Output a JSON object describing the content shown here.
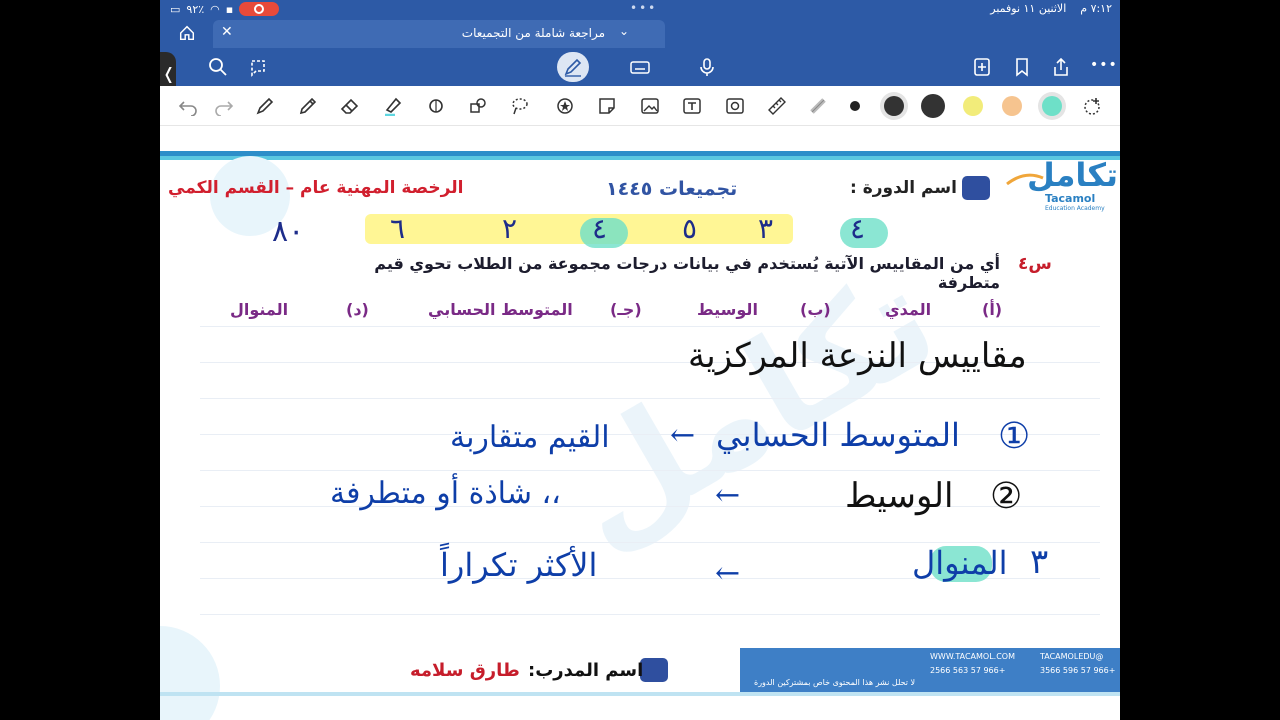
{
  "status_bar": {
    "time": "٧:١٢ م",
    "date": "الاثنين ١١ نوفمبر",
    "battery": "٩٢٪"
  },
  "tab": {
    "title": "مراجعة شاملة من التجميعات"
  },
  "colors": {
    "app_blue": "#2d5aa6",
    "title_red": "#c61d2b",
    "heading_blue": "#3154a3",
    "ink_blue": "#0e3ea8",
    "option_purple": "#7a2a86",
    "highlight_yellow": "#fff58a",
    "highlight_cyan": "#6ee0c8"
  },
  "toolbar_icons": [
    "home-icon",
    "search-icon",
    "lasso-icon",
    "pen-mode-icon",
    "keyboard-icon",
    "microphone-icon",
    "add-page-icon",
    "bookmark-icon",
    "share-icon",
    "more-icon"
  ],
  "pen_tools": [
    "undo-icon",
    "redo-icon",
    "pen-icon",
    "pencil-icon",
    "eraser-icon",
    "highlighter-icon",
    "shapes-icon",
    "elements-icon",
    "lasso-select-icon",
    "sticker-icon",
    "stickynote-icon",
    "image-icon",
    "textbox-icon",
    "camera-icon",
    "ruler-icon",
    "tape-icon"
  ],
  "doc": {
    "header_right": "اسم الدورة :",
    "header_mid": "تجميعات ١٤٤٥",
    "header_left": "الرخصة المهنية عام – القسم الكمي",
    "logo_arabic": "تكامل",
    "logo_latin": "Tacamol",
    "logo_sub": "Education Academy",
    "answers_written": [
      "٤",
      "٣",
      "٥",
      "٤",
      "٢",
      "٦"
    ],
    "score": "٨٠",
    "question_label": "س٤",
    "question_text": "أي من المقاييس الآتية يُستخدم في بيانات درجات مجموعة من الطلاب تحوي قيم متطرفة",
    "options": [
      {
        "letter": "(أ)",
        "text": "المدي"
      },
      {
        "letter": "(ب)",
        "text": "الوسيط"
      },
      {
        "letter": "(جـ)",
        "text": "المتوسط الحسابي"
      },
      {
        "letter": "(د)",
        "text": "المنوال"
      }
    ],
    "handwriting": {
      "title": "مقاييس النزعة المركزية",
      "line1_num": "①",
      "line1_term": "المتوسط الحسابي",
      "line1_arrow": "←",
      "line1_note": "القيم متقاربة",
      "line2_num": "②",
      "line2_term": "الوسيط",
      "line2_arrow": "←",
      "line2_note": "،، شاذة أو متطرفة",
      "line3_num": "٣",
      "line3_term": "المنوال",
      "line3_arrow": "←",
      "line3_note": "الأكثر تكراراً"
    },
    "trainer_label": "اسم المدرب:",
    "trainer_name": "طارق سلامه",
    "footer": {
      "site": "WWW.TACAMOL.COM",
      "handle": "@TACAMOLEDU",
      "phone1": "+966 57 563 2566",
      "phone2": "+966 57 596 3566",
      "notice": "لا تحلل نشر هذا المحتوى خاص بمشتركين الدورة"
    }
  }
}
